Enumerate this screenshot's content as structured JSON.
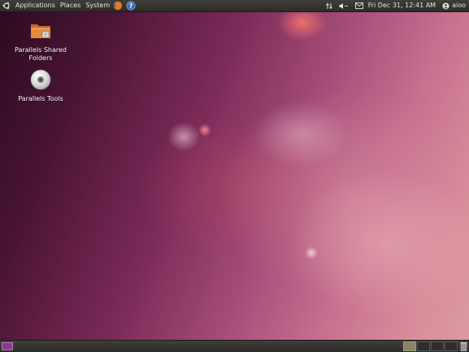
{
  "top_panel": {
    "menus": [
      "Applications",
      "Places",
      "System"
    ],
    "clock": "Fri Dec 31, 12:41 AM",
    "user": "aioo"
  },
  "desktop": {
    "icons": [
      {
        "label": "Parallels Shared Folders",
        "icon": "folder-icon"
      },
      {
        "label": "Parallels Tools",
        "icon": "cd-disc-icon"
      }
    ]
  },
  "bottom_panel": {
    "workspaces": 4,
    "active_workspace": 1
  },
  "colors": {
    "panel": "#3a3935",
    "panel_text": "#e6e4dc",
    "wallpaper_dark": "#2b0a1f",
    "wallpaper_light": "#dc9aa0"
  }
}
